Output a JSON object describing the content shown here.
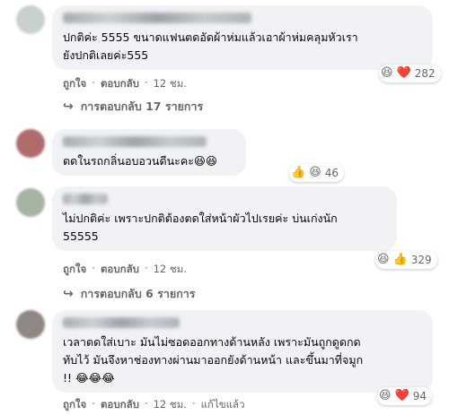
{
  "comments": [
    {
      "text": "ปกติค่ะ 5555 ขนาดแฟนตดอัดผ้าห่มแล้วเอาผ้าห่มคลุมหัวเรา\nยังปกติเลยค่ะ555",
      "reactions": "282",
      "reaction_icons": [
        "😆",
        "❤️"
      ],
      "like": "ถูกใจ",
      "reply": "ตอบกลับ",
      "time": "12 ชม.",
      "replies_label": "การตอบกลับ 17 รายการ",
      "avatar_color": "#c9d1cc"
    },
    {
      "text": "ตดในรถกลิ่นอบอวนดีนะคะ😆😆",
      "reactions": "46",
      "reaction_icons": [
        "👍",
        "😆"
      ],
      "avatar_color": "#b06b6b"
    },
    {
      "text": "ไม่ปกติค่ะ เพราะปกติต้องตดใส่หน้าผัวไปเรยค่ะ บ่นเก่งนัก\n55555",
      "reactions": "329",
      "reaction_icons": [
        "😆",
        "👍"
      ],
      "like": "ถูกใจ",
      "reply": "ตอบกลับ",
      "time": "12 ชม.",
      "replies_label": "การตอบกลับ 6 รายการ",
      "avatar_color": "#a7b3a2"
    },
    {
      "text": "เวลาตดใส่เบาะ มันไม่ซอดออกทางด้านหลัง เพราะมันถูกดูดกด\nทับไว้ มันจึงหาช่องทางผ่านมาออกยังด้านหน้า และขึ้นมาที่จมูก\n!! 😂😂😂",
      "reactions": "94",
      "reaction_icons": [
        "😆",
        "❤️"
      ],
      "like": "ถูกใจ",
      "reply": "ตอบกลับ",
      "time": "12 ชม.",
      "edited": "แก้ไขแล้ว",
      "avatar_color": "#8f8784"
    }
  ]
}
